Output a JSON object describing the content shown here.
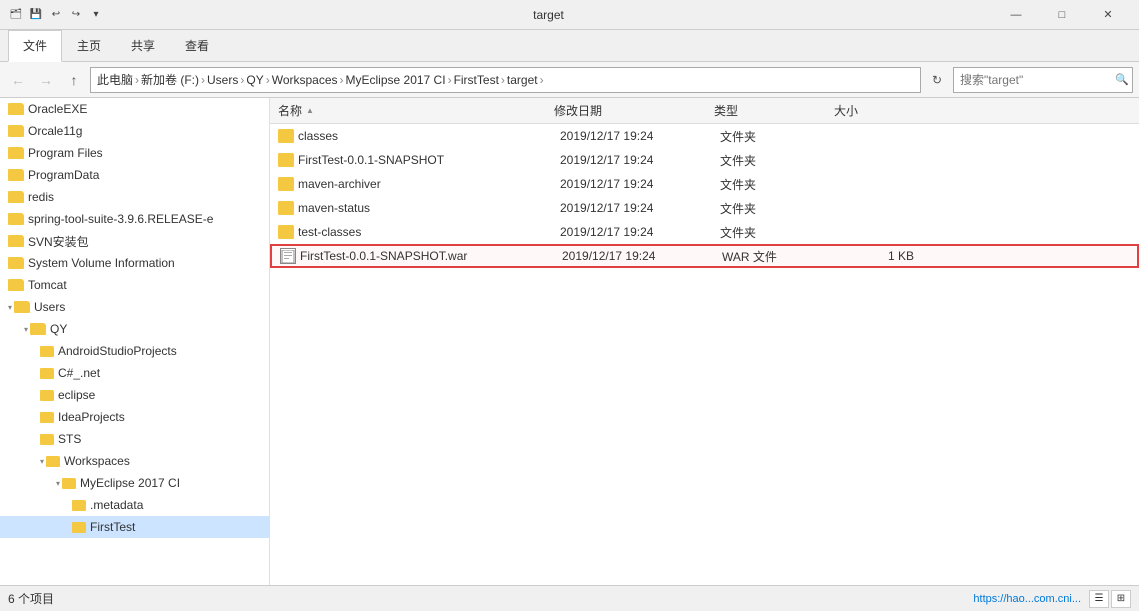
{
  "titlebar": {
    "title": "target",
    "minimize": "—",
    "maximize": "□",
    "close": "✕"
  },
  "ribbon": {
    "tabs": [
      "文件",
      "主页",
      "共享",
      "查看"
    ]
  },
  "addressbar": {
    "back_tooltip": "后退",
    "forward_tooltip": "前进",
    "up_tooltip": "向上",
    "path": [
      "此电脑",
      "新加卷 (F:)",
      "Users",
      "QY",
      "Workspaces",
      "MyEclipse 2017 CI",
      "FirstTest",
      "target"
    ],
    "refresh_tooltip": "刷新",
    "search_placeholder": "搜索\"target\""
  },
  "sidebar": {
    "items": [
      {
        "label": "OracleEXE",
        "indent": 0
      },
      {
        "label": "Orcale11g",
        "indent": 0
      },
      {
        "label": "Program Files",
        "indent": 0
      },
      {
        "label": "ProgramData",
        "indent": 0
      },
      {
        "label": "redis",
        "indent": 0
      },
      {
        "label": "spring-tool-suite-3.9.6.RELEASE-e",
        "indent": 0
      },
      {
        "label": "SVN安装包",
        "indent": 0
      },
      {
        "label": "System Volume Information",
        "indent": 0
      },
      {
        "label": "Tomcat",
        "indent": 0
      },
      {
        "label": "Users",
        "indent": 0
      },
      {
        "label": "QY",
        "indent": 1
      },
      {
        "label": "AndroidStudioProjects",
        "indent": 2
      },
      {
        "label": "C#_.net",
        "indent": 2
      },
      {
        "label": "eclipse",
        "indent": 2
      },
      {
        "label": "IdeaProjects",
        "indent": 2
      },
      {
        "label": "STS",
        "indent": 2
      },
      {
        "label": "Workspaces",
        "indent": 2
      },
      {
        "label": "MyEclipse 2017 CI",
        "indent": 3
      },
      {
        "label": ".metadata",
        "indent": 4
      },
      {
        "label": "FirstTest",
        "indent": 4,
        "selected": true
      }
    ]
  },
  "columns": {
    "name": "名称",
    "date": "修改日期",
    "type": "类型",
    "size": "大小"
  },
  "files": [
    {
      "name": "classes",
      "date": "2019/12/17 19:24",
      "type": "文件夹",
      "size": "",
      "is_folder": true,
      "is_selected": false
    },
    {
      "name": "FirstTest-0.0.1-SNAPSHOT",
      "date": "2019/12/17 19:24",
      "type": "文件夹",
      "size": "",
      "is_folder": true,
      "is_selected": false
    },
    {
      "name": "maven-archiver",
      "date": "2019/12/17 19:24",
      "type": "文件夹",
      "size": "",
      "is_folder": true,
      "is_selected": false
    },
    {
      "name": "maven-status",
      "date": "2019/12/17 19:24",
      "type": "文件夹",
      "size": "",
      "is_folder": true,
      "is_selected": false
    },
    {
      "name": "test-classes",
      "date": "2019/12/17 19:24",
      "type": "文件夹",
      "size": "",
      "is_folder": true,
      "is_selected": false
    },
    {
      "name": "FirstTest-0.0.1-SNAPSHOT.war",
      "date": "2019/12/17 19:24",
      "type": "WAR 文件",
      "size": "1 KB",
      "is_folder": false,
      "is_selected": true
    }
  ],
  "statusbar": {
    "item_count": "6 个项目",
    "url_preview": "https://hao...com.cni..."
  }
}
